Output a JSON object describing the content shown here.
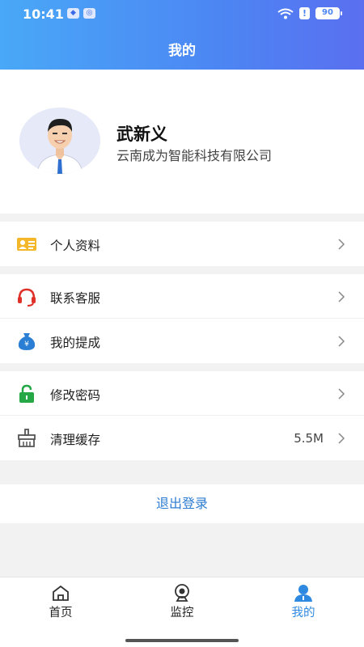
{
  "status_bar": {
    "time": "10:41",
    "battery": "90"
  },
  "header": {
    "title": "我的"
  },
  "profile": {
    "name": "武新义",
    "company": "云南成为智能科技有限公司"
  },
  "menu_groups": [
    {
      "items": [
        {
          "label": "个人资料",
          "icon": "id-card-icon"
        }
      ]
    },
    {
      "items": [
        {
          "label": "联系客服",
          "icon": "headset-icon"
        },
        {
          "label": "我的提成",
          "icon": "money-bag-icon"
        }
      ]
    },
    {
      "items": [
        {
          "label": "修改密码",
          "icon": "lock-icon"
        },
        {
          "label": "清理缓存",
          "icon": "broom-icon",
          "value": "5.5M"
        }
      ]
    }
  ],
  "logout_label": "退出登录",
  "tabs": [
    {
      "label": "首页",
      "icon": "home-icon",
      "active": false
    },
    {
      "label": "监控",
      "icon": "camera-icon",
      "active": false
    },
    {
      "label": "我的",
      "icon": "user-icon",
      "active": true
    }
  ],
  "colors": {
    "header_gradient_start": "#49a8f7",
    "header_gradient_end": "#5a6ff0",
    "active_tab": "#2d8ae0",
    "logout_text": "#2d7dd2"
  }
}
